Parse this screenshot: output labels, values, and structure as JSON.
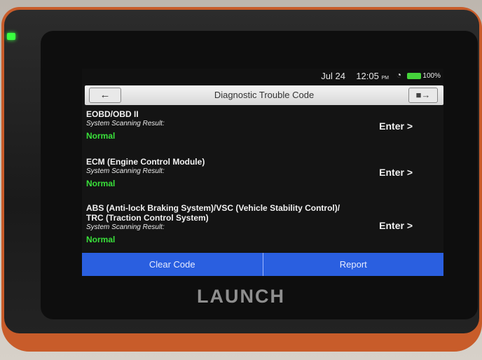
{
  "status_bar": {
    "date": "Jul 24",
    "time": "12:05",
    "ampm": "PM",
    "battery": "100%"
  },
  "header": {
    "title": "Diagnostic Trouble Code",
    "back_icon": "back-arrow-icon",
    "exit_icon": "exit-door-icon"
  },
  "systems": [
    {
      "name": "EOBD/OBD II",
      "label": "System Scanning Result:",
      "status": "Normal",
      "action": "Enter >"
    },
    {
      "name": "ECM (Engine Control Module)",
      "label": "System Scanning Result:",
      "status": "Normal",
      "action": "Enter >"
    },
    {
      "name_line1": "ABS (Anti-lock Braking System)/VSC (Vehicle Stability Control)/",
      "name_line2": "TRC (Traction Control System)",
      "label": "System Scanning Result:",
      "status": "Normal",
      "action": "Enter >"
    }
  ],
  "footer": {
    "clear_code": "Clear Code",
    "report": "Report"
  },
  "device": {
    "brand": "LAUNCH"
  },
  "colors": {
    "status_normal": "#39e03a",
    "button_bar": "#2a5fe0",
    "device_rim": "#c85c2a"
  }
}
